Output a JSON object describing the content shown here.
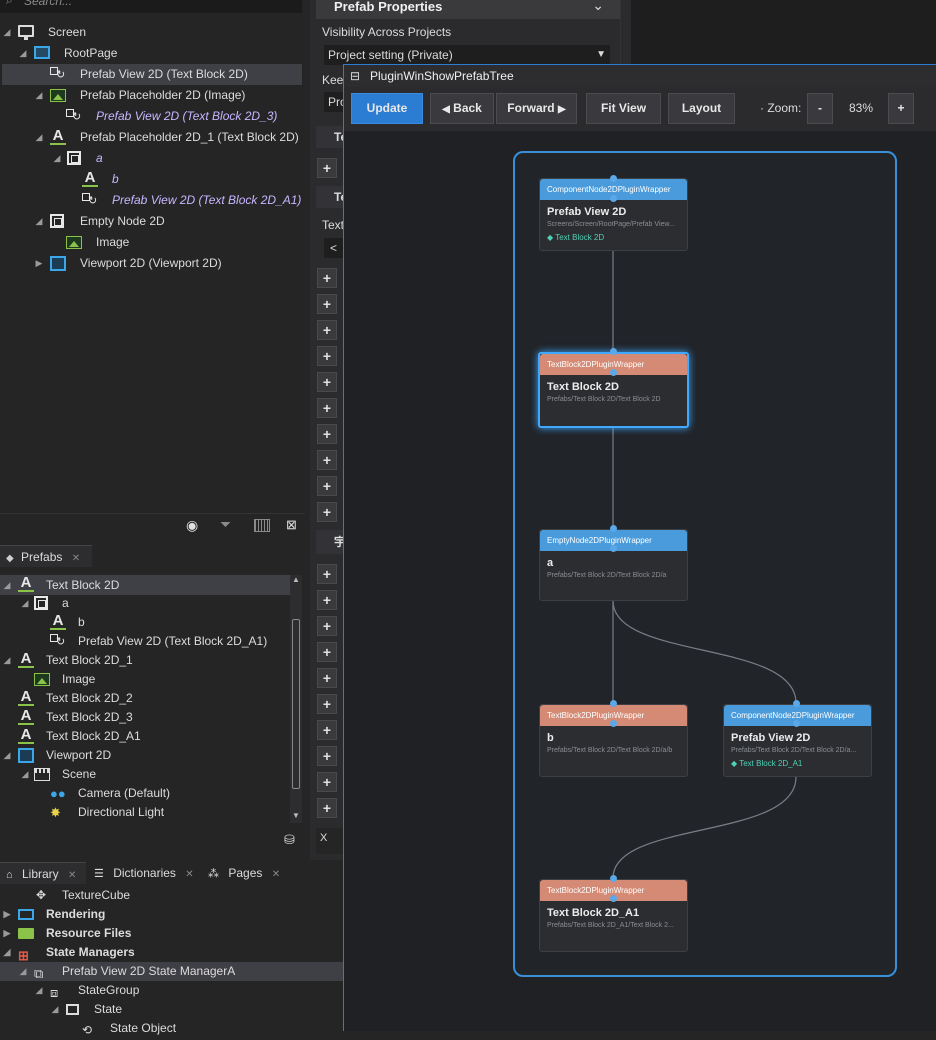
{
  "hierarchy": {
    "search_placeholder": "Search...",
    "items": [
      {
        "label": "Screen"
      },
      {
        "label": "RootPage"
      },
      {
        "label": "Prefab View 2D (Text Block 2D)"
      },
      {
        "label": "Prefab Placeholder 2D (Image)"
      },
      {
        "label": "Prefab View 2D (Text Block 2D_3)"
      },
      {
        "label": "Prefab Placeholder 2D_1 (Text Block 2D)"
      },
      {
        "label": "a"
      },
      {
        "label": "b"
      },
      {
        "label": "Prefab View 2D (Text Block 2D_A1)"
      },
      {
        "label": "Empty Node 2D"
      },
      {
        "label": "Image"
      },
      {
        "label": "Viewport 2D (Viewport 2D)"
      }
    ]
  },
  "properties": {
    "header": "Prefab Properties",
    "visibility_label": "Visibility Across Projects",
    "visibility_value": "Project setting (Private)",
    "keep_label": "Keep",
    "pro_label": "Pro",
    "te_label1": "Te",
    "te_label2": "Te",
    "text_label": "Text",
    "lt": "<",
    "cjk_label": "宇",
    "x_label": "X"
  },
  "prefabs_panel": {
    "tab_label": "Prefabs",
    "items": [
      {
        "label": "Text Block 2D"
      },
      {
        "label": "a"
      },
      {
        "label": "b"
      },
      {
        "label": "Prefab View 2D (Text Block 2D_A1)"
      },
      {
        "label": "Text Block 2D_1"
      },
      {
        "label": "Image"
      },
      {
        "label": "Text Block 2D_2"
      },
      {
        "label": "Text Block 2D_3"
      },
      {
        "label": "Text Block 2D_A1"
      },
      {
        "label": "Viewport 2D"
      },
      {
        "label": "Scene"
      },
      {
        "label": "Camera (Default)"
      },
      {
        "label": "Directional Light"
      }
    ]
  },
  "library": {
    "tabs": [
      {
        "label": "Library"
      },
      {
        "label": "Dictionaries"
      },
      {
        "label": "Pages"
      }
    ],
    "items": [
      {
        "label": "TextureCube"
      },
      {
        "label": "Rendering"
      },
      {
        "label": "Resource Files"
      },
      {
        "label": "State Managers"
      },
      {
        "label": "Prefab View 2D State ManagerA"
      },
      {
        "label": "StateGroup"
      },
      {
        "label": "State"
      },
      {
        "label": "State Object"
      }
    ]
  },
  "plugin_window": {
    "title": "PluginWinShowPrefabTree",
    "buttons": {
      "update": "Update",
      "back": "Back",
      "forward": "Forward",
      "fit_view": "Fit View",
      "layout": "Layout",
      "zoom_minus": "-",
      "zoom_plus": "+"
    },
    "zoom_label": "Zoom:",
    "zoom_value": "83%",
    "nodes": [
      {
        "header": "ComponentNode2DPluginWrapper",
        "title": "Prefab View 2D",
        "path": "Screens/Screen/RootPage/Prefab View...",
        "component": "Text Block 2D"
      },
      {
        "header": "TextBlock2DPluginWrapper",
        "title": "Text Block 2D",
        "path": "Prefabs/Text Block 2D/Text Block 2D"
      },
      {
        "header": "EmptyNode2DPluginWrapper",
        "title": "a",
        "path": "Prefabs/Text Block 2D/Text Block 2D/a"
      },
      {
        "header": "TextBlock2DPluginWrapper",
        "title": "b",
        "path": "Prefabs/Text Block 2D/Text Block 2D/a/b"
      },
      {
        "header": "ComponentNode2DPluginWrapper",
        "title": "Prefab View 2D",
        "path": "Prefabs/Text Block 2D/Text Block 2D/a...",
        "component": "Text Block 2D_A1"
      },
      {
        "header": "TextBlock2DPluginWrapper",
        "title": "Text Block 2D_A1",
        "path": "Prefabs/Text Block 2D_A1/Text Block 2..."
      }
    ]
  },
  "colors": {
    "accent_blue": "#2b7cd3",
    "node_blue": "#4a9bdb",
    "node_orange": "#d48a74",
    "component_teal": "#4fd1b5",
    "selection_glow": "#3fa9ff"
  }
}
